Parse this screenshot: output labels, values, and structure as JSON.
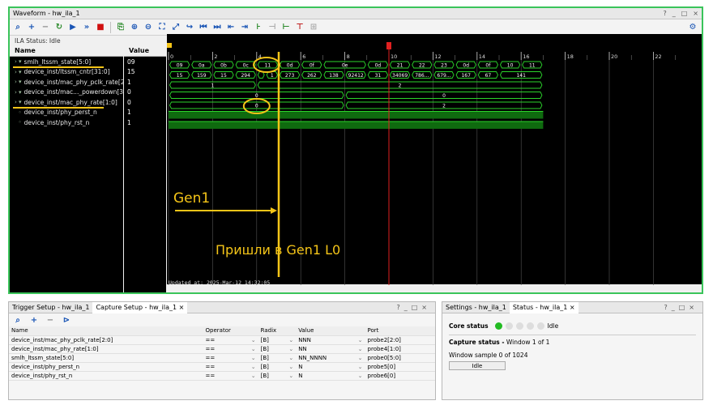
{
  "page_header": "",
  "waveform": {
    "title": "Waveform - hw_ila_1",
    "window_controls": [
      "?",
      "_",
      "□",
      "×"
    ],
    "ila_status": "ILA Status: Idle",
    "name_header": "Name",
    "value_header": "Value",
    "signals": [
      {
        "name": "smlh_ltssm_state[5:0]",
        "value": "09",
        "bus": true
      },
      {
        "name": "device_inst/ltssm_cntr[31:0]",
        "value": "15",
        "bus": true
      },
      {
        "name": "device_inst/mac_phy_pclk_rate[2:0]",
        "value": "1",
        "bus": true
      },
      {
        "name": "device_inst/mac..._powerdown[3:0]",
        "value": "0",
        "bus": true
      },
      {
        "name": "device_inst/mac_phy_rate[1:0]",
        "value": "0",
        "bus": true
      },
      {
        "name": "device_inst/phy_perst_n",
        "value": "1",
        "bus": false
      },
      {
        "name": "device_inst/phy_rst_n",
        "value": "1",
        "bus": false
      }
    ],
    "time_ticks": [
      "0",
      "2",
      "4",
      "6",
      "8",
      "10",
      "12",
      "14",
      "16",
      "18",
      "20",
      "22"
    ],
    "trigger_marker": "T",
    "row0_values": [
      "09",
      "0a",
      "0b",
      "0c",
      "11",
      "0d",
      "0f",
      "0e",
      "0d",
      "21",
      "22",
      "23",
      "0d",
      "0f",
      "10",
      "11"
    ],
    "row1_values": [
      "15",
      "159",
      "15",
      "294",
      "",
      "1",
      "273",
      "262",
      "138",
      "92412",
      "31",
      "34069",
      "786...",
      "679...",
      "167",
      "67",
      "141"
    ],
    "row2_values": [
      "1",
      "2"
    ],
    "row3_values": [
      "0",
      "0"
    ],
    "row4_values": [
      "0",
      "2"
    ],
    "annotation_gen1": "Gen1",
    "annotation_l0": "Пришли в Gen1 L0",
    "updated_at": "Updated at: 2025-Mar-12 14:32:05"
  },
  "trigger_panel": {
    "tabs": [
      "Trigger Setup - hw_ila_1",
      "Capture Setup - hw_ila_1"
    ],
    "columns": [
      "Name",
      "Operator",
      "Radix",
      "Value",
      "Port"
    ],
    "rows": [
      [
        "device_inst/mac_phy_pclk_rate[2:0]",
        "==",
        "[B]",
        "NNN",
        "probe2[2:0]"
      ],
      [
        "device_inst/mac_phy_rate[1:0]",
        "==",
        "[B]",
        "NN",
        "probe4[1:0]"
      ],
      [
        "smlh_ltssm_state[5:0]",
        "==",
        "[B]",
        "NN_NNNN",
        "probe0[5:0]"
      ],
      [
        "device_inst/phy_perst_n",
        "==",
        "[B]",
        "N",
        "probe5[0]"
      ],
      [
        "device_inst/phy_rst_n",
        "==",
        "[B]",
        "N",
        "probe6[0]"
      ]
    ]
  },
  "status_panel": {
    "tabs": [
      "Settings - hw_ila_1",
      "Status - hw_ila_1"
    ],
    "core_status_label": "Core status",
    "core_status_value": "Idle",
    "capture_status_label": "Capture status -",
    "capture_status_window": "Window 1 of 1",
    "window_sample": "Window sample 0 of 1024",
    "state_button": "Idle"
  },
  "colors": {
    "accent_green": "#3ac45a",
    "wave_green": "#2bd42b",
    "annotation": "#f5c518",
    "trigger": "#e02020"
  }
}
